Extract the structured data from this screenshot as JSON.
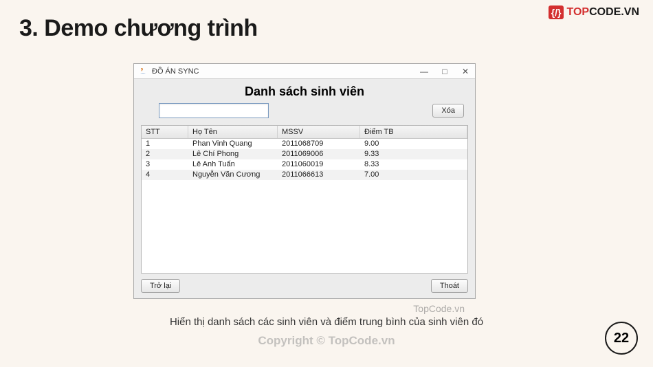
{
  "slide": {
    "title": "3. Demo chương trình",
    "caption": "Hiển thị danh sách các sinh viên và điểm trung bình của sinh viên đó",
    "page_number": "22",
    "watermark_small": "TopCode.vn",
    "watermark_large": "Copyright © TopCode.vn"
  },
  "brand": {
    "icon_glyph": "{/}",
    "name_red": "TOP",
    "name_black": "CODE.VN"
  },
  "window": {
    "title": "ĐỒ ÁN SYNC",
    "heading": "Danh sách sinh viên",
    "search_value": "",
    "search_placeholder": "",
    "buttons": {
      "delete": "Xóa",
      "back": "Trở lại",
      "exit": "Thoát"
    },
    "controls": {
      "minimize": "—",
      "maximize": "□",
      "close": "✕"
    },
    "table": {
      "headers": {
        "stt": "STT",
        "name": "Họ Tên",
        "mssv": "MSSV",
        "gpa": "Điểm TB"
      },
      "rows": [
        {
          "stt": "1",
          "name": "Phan Vinh Quang",
          "mssv": "2011068709",
          "gpa": "9.00"
        },
        {
          "stt": "2",
          "name": "Lê Chí Phong",
          "mssv": "2011069006",
          "gpa": "9.33"
        },
        {
          "stt": "3",
          "name": "Lê Anh Tuấn",
          "mssv": "2011060019",
          "gpa": "8.33"
        },
        {
          "stt": "4",
          "name": "Nguyễn Văn Cương",
          "mssv": "2011066613",
          "gpa": "7.00"
        }
      ]
    }
  }
}
